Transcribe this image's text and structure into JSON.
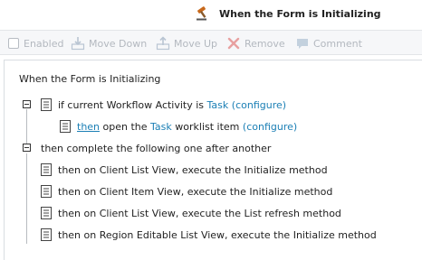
{
  "header": {
    "title": "When the Form is Initializing",
    "icon": "gavel-icon"
  },
  "toolbar": {
    "enabled_label": "Enabled",
    "move_down_label": "Move Down",
    "move_up_label": "Move Up",
    "remove_label": "Remove",
    "comment_label": "Comment"
  },
  "tree": {
    "root_title": "When the Form is Initializing",
    "condition": {
      "prefix": "if current Workflow Activity is ",
      "link": "Task",
      "configure": "(configure)"
    },
    "then_action": {
      "then": "then",
      "mid": " open the ",
      "link": "Task",
      "suffix": " worklist item ",
      "configure": "(configure)"
    },
    "sequence_label": "then complete the following one after another",
    "actions": [
      "then on Client List View, execute the Initialize method",
      "then on Client Item View, execute the Initialize method",
      "then on Client List View, execute the List refresh method",
      "then on Region Editable List View, execute the Initialize method"
    ]
  },
  "colors": {
    "link": "#1b7fb5",
    "disabled": "#b3b8bf",
    "remove_icon": "#e8a0a0",
    "header_icon": "#c8691c"
  }
}
